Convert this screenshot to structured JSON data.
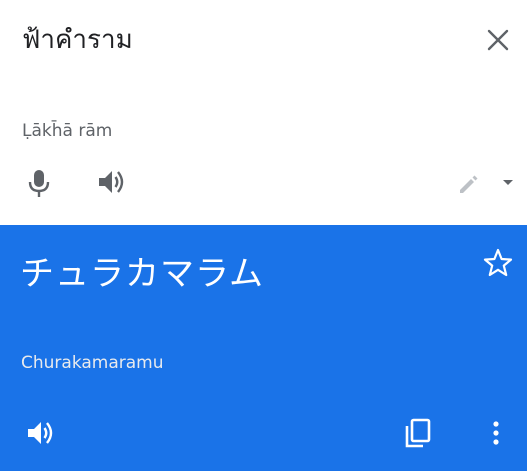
{
  "source": {
    "text": "ฟ้าคำราม",
    "transliteration": "Ḷākh̄ā rām"
  },
  "target": {
    "text": "チュラカマラム",
    "transliteration": "Churakamaramu"
  },
  "icons": {
    "close": "close-icon",
    "mic": "mic-icon",
    "speaker": "speaker-icon",
    "edit": "edit-icon",
    "dropdown": "chevron-down-icon",
    "star": "star-outline-icon",
    "copy": "copy-icon",
    "more": "more-vert-icon"
  },
  "colors": {
    "accent": "#1a73e8",
    "source_text": "#202124",
    "muted_text": "#5f6368",
    "icon_gray": "#5f6368",
    "icon_light": "#bdc1c6",
    "on_accent": "#ffffff"
  }
}
